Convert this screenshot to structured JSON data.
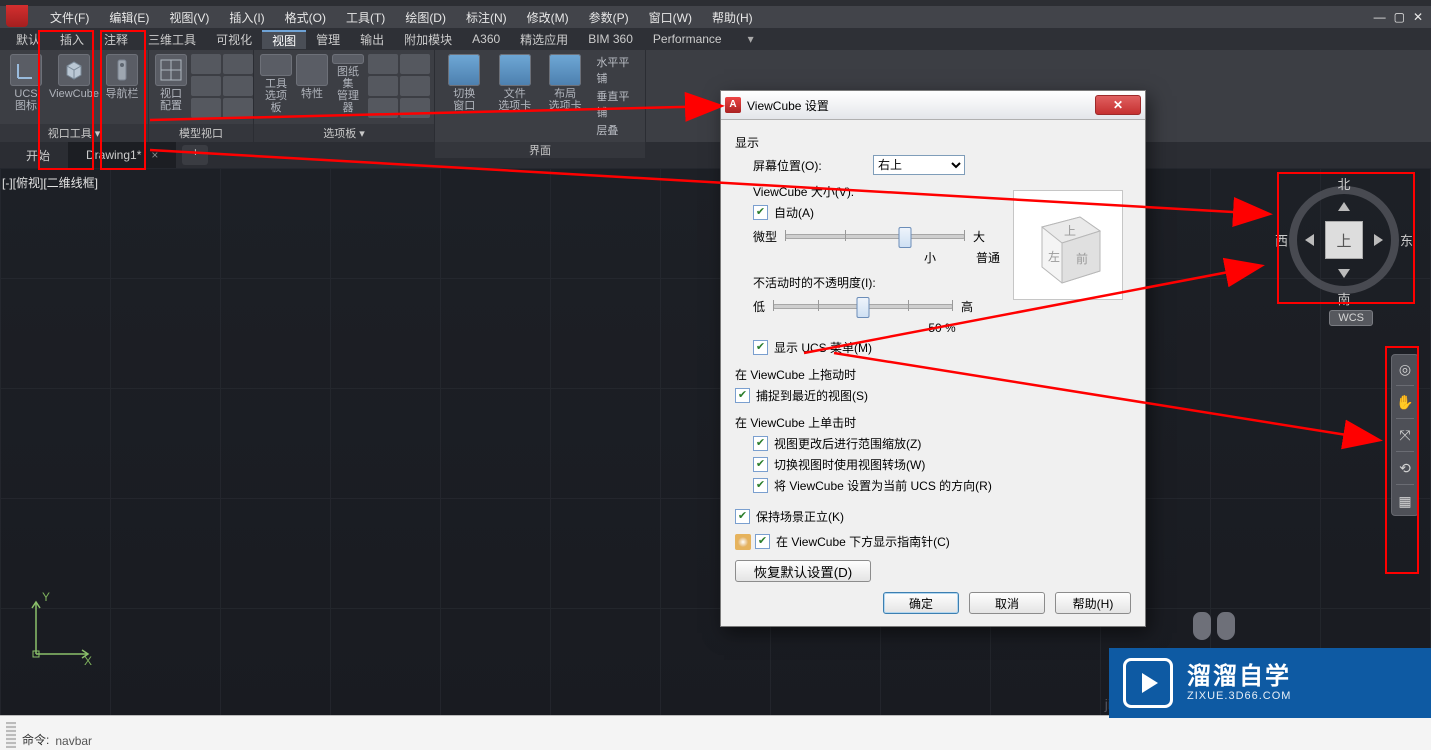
{
  "menubar": {
    "file": "文件(F)",
    "edit": "编辑(E)",
    "view": "视图(V)",
    "insert": "插入(I)",
    "format": "格式(O)",
    "tools": "工具(T)",
    "draw": "绘图(D)",
    "annotate": "标注(N)",
    "modify": "修改(M)",
    "params": "参数(P)",
    "window": "窗口(W)",
    "help": "帮助(H)"
  },
  "wincontrols": {
    "min": "—",
    "restore": "▢",
    "close": "✕"
  },
  "ribbontabs": {
    "default": "默认",
    "insert": "插入",
    "annotate": "注释",
    "d3": "三维工具",
    "visualize": "可视化",
    "view": "视图",
    "manage": "管理",
    "output": "输出",
    "addons": "附加模块",
    "a360": "A360",
    "featured": "精选应用",
    "bim": "BIM 360",
    "perf": "Performance"
  },
  "ribbon": {
    "panel1": {
      "b1": "UCS\n图标",
      "b2": "ViewCube",
      "b3": "导航栏",
      "label": "视口工具 ▾"
    },
    "panel2": {
      "b1": "视口\n配置",
      "label": "模型视口"
    },
    "panel3": {
      "b1": "工具\n选项板",
      "b2": "特性",
      "b3": "图纸集\n管理器",
      "label": "选项板 ▾"
    },
    "panel4": {
      "b1": "切换\n窗口",
      "b2": "文件\n选项卡",
      "b3": "布局\n选项卡",
      "sideA": "水平平铺",
      "sideB": "垂直平铺",
      "sideC": "层叠",
      "label": "界面"
    }
  },
  "doctabs": {
    "start": "开始",
    "drawing": "Drawing1*"
  },
  "viewport": {
    "label": "[-][俯视][二维线框]",
    "ucs_y": "Y",
    "ucs_x": "X"
  },
  "viewcube": {
    "face": "上",
    "n": "北",
    "s": "南",
    "w": "西",
    "e": "东",
    "wcs": "WCS"
  },
  "navtools": {
    "wheel": "◎",
    "pan": "✋",
    "zoom": "⤧",
    "orbit": "⟲",
    "show": "▦"
  },
  "cmd": {
    "label": "命令:",
    "text": "navbar"
  },
  "dialog": {
    "title": "ViewCube 设置",
    "sec_display": "显示",
    "screenpos_label": "屏幕位置(O):",
    "screenpos_value": "右上",
    "size_label": "ViewCube 大小(V):",
    "auto": "自动(A)",
    "size_min": "微型",
    "size_small": "小",
    "size_normal": "普通",
    "size_big": "大",
    "opacity_label": "不活动时的不透明度(I):",
    "opacity_low": "低",
    "opacity_high": "高",
    "opacity_value": "50 %",
    "show_ucs": "显示 UCS 菜单(M)",
    "sec_drag": "在 ViewCube 上拖动时",
    "snap": "捕捉到最近的视图(S)",
    "sec_click": "在 ViewCube 上单击时",
    "zoom_extents": "视图更改后进行范围缩放(Z)",
    "transitions": "切换视图时使用视图转场(W)",
    "set_ucs": "将 ViewCube 设置为当前 UCS 的方向(R)",
    "keep_upright": "保持场景正立(K)",
    "show_compass": "在 ViewCube 下方显示指南针(C)",
    "restore": "恢复默认设置(D)",
    "ok": "确定",
    "cancel": "取消",
    "help": "帮助(H)"
  },
  "banner": {
    "cn": "溜溜自学",
    "en": "ZIXUE.3D66.COM"
  },
  "jingyan": "ji"
}
